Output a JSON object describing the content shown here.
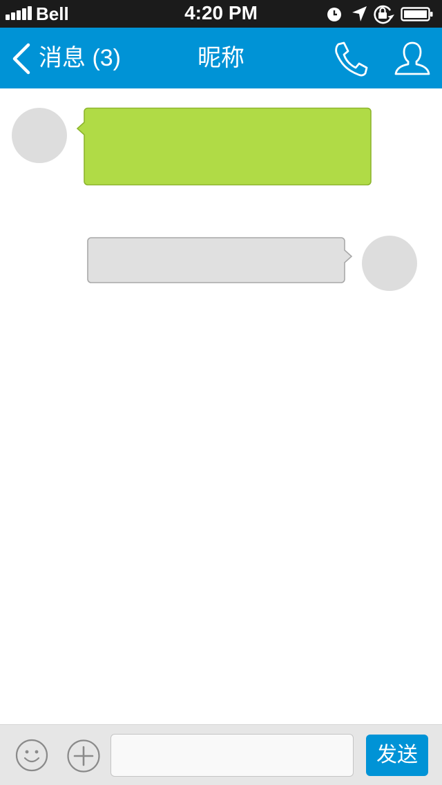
{
  "status_bar": {
    "carrier": "Bell",
    "time": "4:20 PM",
    "icons": [
      "signal-icon",
      "alarm-clock-icon",
      "location-arrow-icon",
      "rotation-lock-icon",
      "battery-icon"
    ]
  },
  "nav": {
    "back_label": "消息 (3)",
    "title": "昵称",
    "back_icon": "chevron-left-icon",
    "call_icon": "phone-icon",
    "contact_icon": "person-icon"
  },
  "messages": [
    {
      "sender": "other",
      "text": "",
      "bubble_color": "#b0db46",
      "bubble_border": "#8db52e"
    },
    {
      "sender": "self",
      "text": "",
      "bubble_color": "#e0e0e0",
      "bubble_border": "#a8a8a8"
    }
  ],
  "input_bar": {
    "emoji_icon": "smiley-icon",
    "add_icon": "plus-circle-icon",
    "input_value": "",
    "input_placeholder": "",
    "send_label": "发送"
  },
  "colors": {
    "accent": "#0093d6",
    "status_bar_bg": "#1b1b1b",
    "avatar_placeholder": "#dddddd"
  }
}
